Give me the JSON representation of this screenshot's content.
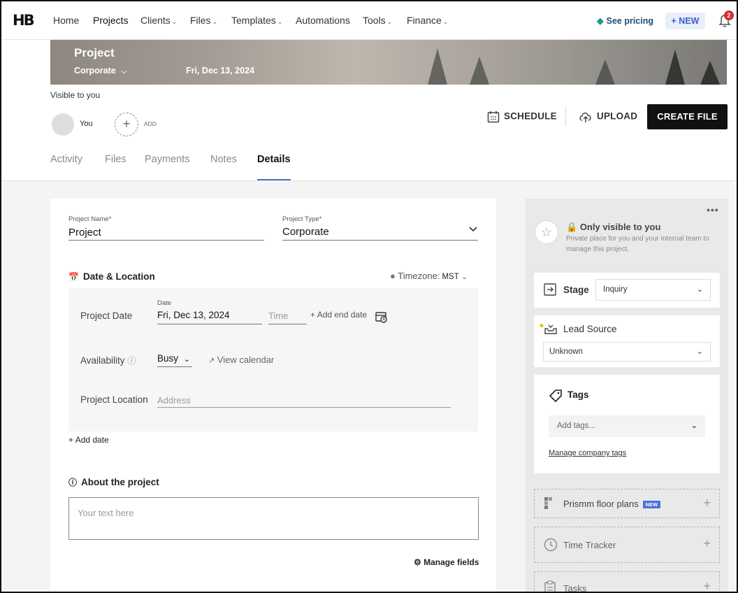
{
  "nav": {
    "logo": "HB",
    "items": [
      {
        "label": "Home",
        "chevron": false
      },
      {
        "label": "Projects",
        "chevron": false
      },
      {
        "label": "Clients",
        "chevron": true
      },
      {
        "label": "Files",
        "chevron": true
      },
      {
        "label": "Templates",
        "chevron": true
      },
      {
        "label": "Automations",
        "chevron": false
      },
      {
        "label": "Tools",
        "chevron": true
      },
      {
        "label": "Finance",
        "chevron": true
      }
    ],
    "pricing": "See pricing",
    "new_label": "NEW",
    "notifications": "2"
  },
  "banner": {
    "title": "Project",
    "type": "Corporate",
    "date": "Fri, Dec 13, 2024"
  },
  "visibility": {
    "label": "Visible to you",
    "you": "You",
    "add": "ADD"
  },
  "actions": {
    "schedule": "SCHEDULE",
    "upload": "UPLOAD",
    "create_file": "CREATE FILE"
  },
  "tabs": [
    "Activity",
    "Files",
    "Payments",
    "Notes",
    "Details"
  ],
  "active_tab": "Details",
  "details": {
    "project_name_label": "Project Name*",
    "project_name": "Project",
    "project_type_label": "Project Type*",
    "project_type": "Corporate",
    "date_location_title": "Date & Location",
    "timezone_label": "Timezone:",
    "timezone": "MST",
    "project_date_label": "Project Date",
    "date_label": "Date",
    "date_value": "Fri, Dec 13, 2024",
    "time_placeholder": "Time",
    "add_end_date": "Add end date",
    "availability_label": "Availability",
    "availability_value": "Busy",
    "view_calendar": "View calendar",
    "location_label": "Project Location",
    "address_placeholder": "Address",
    "add_date": "Add date",
    "about_title": "About the project",
    "about_placeholder": "Your text here",
    "manage_fields": "Manage fields"
  },
  "sidebar": {
    "private_title": "Only visible to you",
    "private_desc": "Private place for you and your internal team to manage this project.",
    "stage_label": "Stage",
    "stage_value": "Inquiry",
    "lead_source_label": "Lead Source",
    "lead_source_value": "Unknown",
    "tags_label": "Tags",
    "tags_placeholder": "Add tags...",
    "manage_tags": "Manage company tags",
    "prismm": "Prismm floor plans",
    "prismm_badge": "NEW",
    "time_tracker": "Time Tracker",
    "tasks": "Tasks"
  },
  "colors": {
    "accent": "#4a6fd8",
    "primary_button": "#111111",
    "badge": "#d32f2f",
    "gem": "#159a8f"
  }
}
